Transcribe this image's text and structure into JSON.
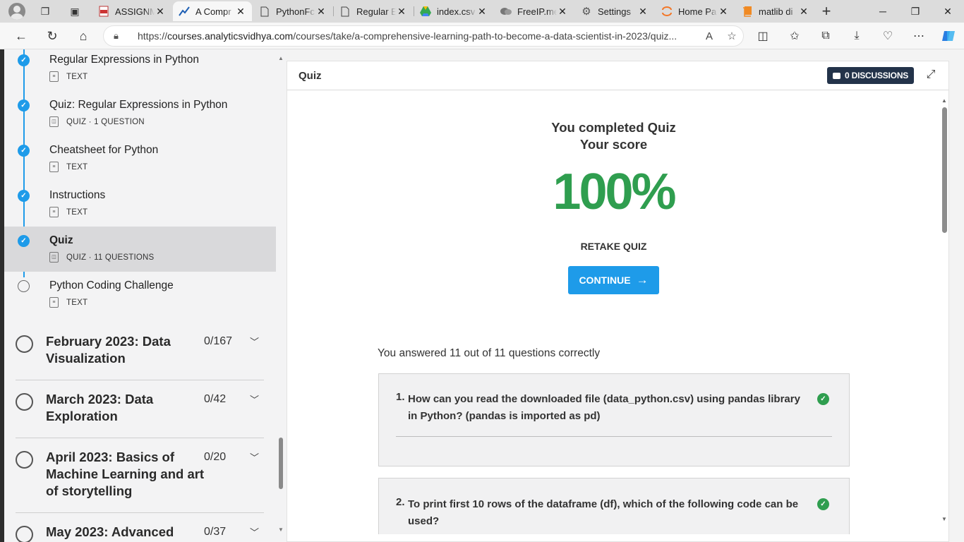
{
  "browser": {
    "tabs": [
      {
        "title": "ASSIGNM",
        "favicon": "pdf-icon",
        "active": false
      },
      {
        "title": "A Compr",
        "favicon": "analyticsvidhya-icon",
        "active": true
      },
      {
        "title": "PythonFc",
        "favicon": "document-icon",
        "active": false
      },
      {
        "title": "Regular E",
        "favicon": "document-icon",
        "active": false
      },
      {
        "title": "index.csv",
        "favicon": "google-drive-icon",
        "active": false
      },
      {
        "title": "FreeIP.me",
        "favicon": "chat-icon",
        "active": false
      },
      {
        "title": "Settings",
        "favicon": "gear-icon",
        "active": false
      },
      {
        "title": "Home Pa",
        "favicon": "jupyter-icon",
        "active": false
      },
      {
        "title": "matlib di",
        "favicon": "book-icon",
        "active": false
      }
    ],
    "url_prefix": "https://",
    "url_host": "courses.analyticsvidhya.com",
    "url_path": "/courses/take/a-comprehensive-learning-path-to-become-a-data-scientist-in-2023/quiz..."
  },
  "sidebar": {
    "lessons": [
      {
        "title": "Regular Expressions in Python",
        "meta": "TEXT",
        "type": "text",
        "completed": true
      },
      {
        "title": "Quiz: Regular Expressions in Python",
        "meta": "QUIZ · 1 QUESTION",
        "type": "quiz",
        "completed": true
      },
      {
        "title": "Cheatsheet for Python",
        "meta": "TEXT",
        "type": "text",
        "completed": true
      },
      {
        "title": "Instructions",
        "meta": "TEXT",
        "type": "text",
        "completed": true
      },
      {
        "title": "Quiz",
        "meta": "QUIZ · 11 QUESTIONS",
        "type": "quiz",
        "completed": true,
        "current": true
      },
      {
        "title": "Python Coding Challenge",
        "meta": "TEXT",
        "type": "text",
        "completed": false
      }
    ],
    "sections": [
      {
        "title": "February 2023: Data Visualization",
        "count": "0/167"
      },
      {
        "title": "March 2023: Data Exploration",
        "count": "0/42"
      },
      {
        "title": "April 2023: Basics of Machine Learning and art of storytelling",
        "count": "0/20"
      },
      {
        "title": "May 2023: Advanced",
        "count": "0/37"
      }
    ]
  },
  "main": {
    "header_title": "Quiz",
    "discussions_label": "0 DISCUSSIONS",
    "completed_line1": "You completed Quiz",
    "completed_line2": "Your score",
    "score": "100%",
    "retake_label": "RETAKE QUIZ",
    "continue_label": "CONTINUE",
    "answered_text": "You answered 11 out of 11 questions correctly",
    "questions": [
      {
        "number": "1.",
        "text": "How can you read the downloaded file (data_python.csv) using pandas library in Python? (pandas is imported as pd)",
        "correct": true
      },
      {
        "number": "2.",
        "text": "To print first 10 rows of the dataframe (df), which of the following code can be used?",
        "correct": true
      }
    ]
  },
  "colors": {
    "accent": "#1e9be9",
    "score_green": "#2f9e4f",
    "discussion_button": "#23334a"
  }
}
